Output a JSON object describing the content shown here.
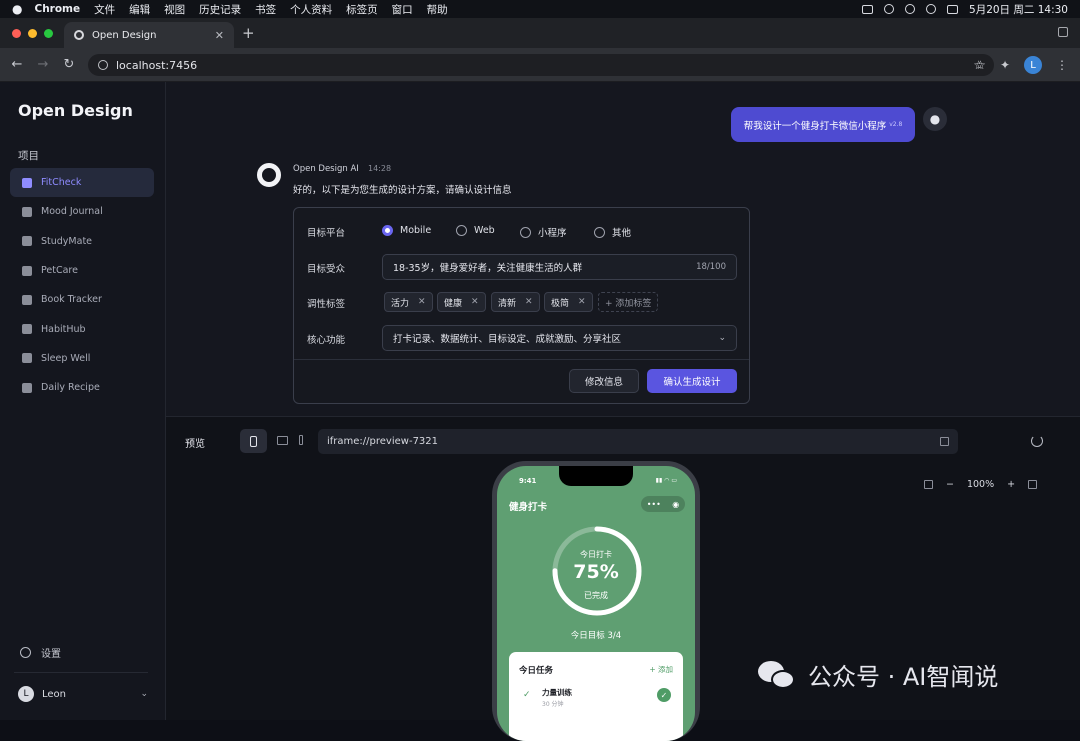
{
  "menubar": {
    "app": "Chrome",
    "items": [
      "文件",
      "编辑",
      "视图",
      "历史记录",
      "书签",
      "个人资料",
      "标签页",
      "窗口",
      "帮助"
    ],
    "clock": "5月20日 周二 14:30"
  },
  "browser": {
    "tab_title": "Open Design",
    "url": "localhost:7456",
    "profile_initial": "L"
  },
  "sidebar": {
    "brand": "Open Design",
    "section_label": "项目",
    "projects": [
      "FitCheck",
      "Mood Journal",
      "StudyMate",
      "PetCare",
      "Book Tracker",
      "HabitHub",
      "Sleep Well",
      "Daily Recipe"
    ],
    "active_project": "FitCheck",
    "settings_label": "设置",
    "user_initial": "L",
    "user_name": "Leon"
  },
  "chat": {
    "user_message": "帮我设计一个健身打卡微信小程序",
    "user_message_version": "v2.8",
    "ai_name": "Open Design AI",
    "ai_time": "14:28",
    "ai_text": "好的，以下是为您生成的设计方案，请确认设计信息"
  },
  "form": {
    "platform_label": "目标平台",
    "platforms": [
      "Mobile",
      "Web",
      "小程序",
      "其他"
    ],
    "platform_selected": "Mobile",
    "audience_label": "目标受众",
    "audience_value": "18-35岁，健身爱好者，关注健康生活的人群",
    "audience_count": "18/100",
    "tags_label": "调性标签",
    "tags": [
      "活力",
      "健康",
      "清新",
      "极简"
    ],
    "add_tag": "+ 添加标签",
    "features_label": "核心功能",
    "features_value": "打卡记录、数据统计、目标设定、成就激励、分享社区",
    "edit_button": "修改信息",
    "confirm_button": "确认生成设计"
  },
  "preview": {
    "label": "预览",
    "url": "iframe://preview-7321",
    "zoom": "100%"
  },
  "phone": {
    "time": "9:41",
    "title": "健身打卡",
    "ring_top": "今日打卡",
    "ring_pct": "75%",
    "ring_progress": 0.75,
    "ring_bottom": "已完成",
    "goal": "今日目标  3/4",
    "tasks_title": "今日任务",
    "tasks_add": "+ 添加",
    "task1_name": "力量训练",
    "task1_sub": "30 分钟"
  },
  "watermark": "公众号 · AI智闻说",
  "icons": {
    "menubar": [
      "apple-icon",
      "wifi-icon",
      "battery-icon"
    ],
    "nav": [
      "back-icon",
      "forward-icon",
      "reload-icon",
      "site-info-icon",
      "bookmark-star-icon",
      "extensions-icon"
    ]
  }
}
